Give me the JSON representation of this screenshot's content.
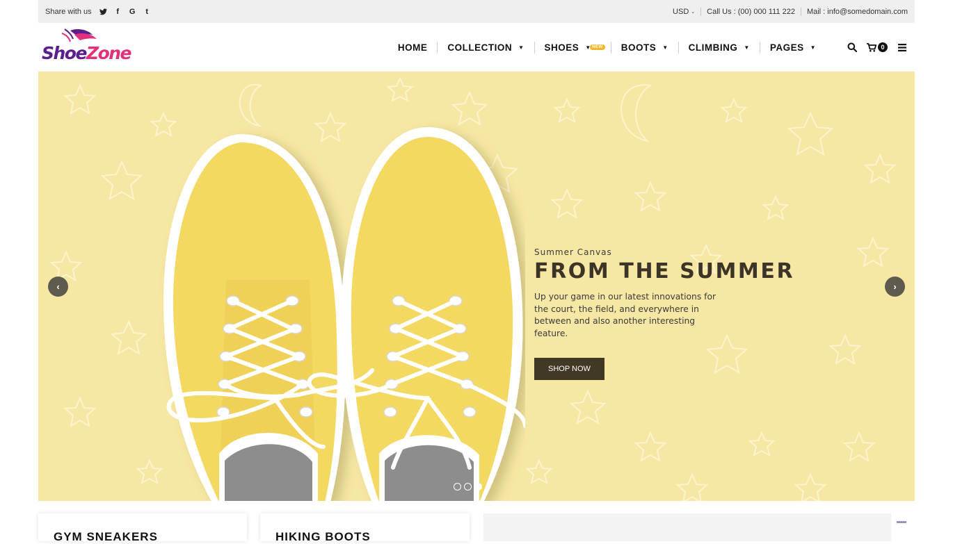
{
  "topbar": {
    "share_label": "Share with us",
    "social": [
      {
        "icon": "twitter-icon",
        "glyph": "✦"
      },
      {
        "icon": "facebook-icon",
        "glyph": "f"
      },
      {
        "icon": "google-icon",
        "glyph": "G"
      },
      {
        "icon": "tumblr-icon",
        "glyph": "t"
      }
    ],
    "currency": "USD",
    "call": "Call Us : (00) 000 111 222",
    "mail": "Mail : info@somedomain.com"
  },
  "logo": {
    "part1": "Shoe",
    "part2": "Zone"
  },
  "nav": {
    "items": [
      {
        "label": "HOME",
        "dropdown": false
      },
      {
        "label": "COLLECTION",
        "dropdown": true
      },
      {
        "label": "SHOES",
        "dropdown": true,
        "badge": "NEW"
      },
      {
        "label": "BOOTS",
        "dropdown": true
      },
      {
        "label": "CLIMBING",
        "dropdown": true
      },
      {
        "label": "PAGES",
        "dropdown": true
      }
    ],
    "cart_count": "0"
  },
  "hero": {
    "subtitle": "Summer Canvas",
    "title": "FROM THE SUMMER",
    "description": "Up your game in our latest innovations for the court, the field, and everywhere in between and also another interesting feature.",
    "button": "SHOP NOW",
    "slides": 3,
    "active_slide": 3
  },
  "cards": [
    {
      "title": "GYM SNEAKERS"
    },
    {
      "title": "HIKING BOOTS"
    }
  ],
  "colors": {
    "hero_bg": "#f6e7a4",
    "shoe": "#f3d862",
    "button": "#423826",
    "badge": "#f3b728",
    "logo_purple": "#5b1d8f",
    "logo_pink": "#e2307c"
  }
}
